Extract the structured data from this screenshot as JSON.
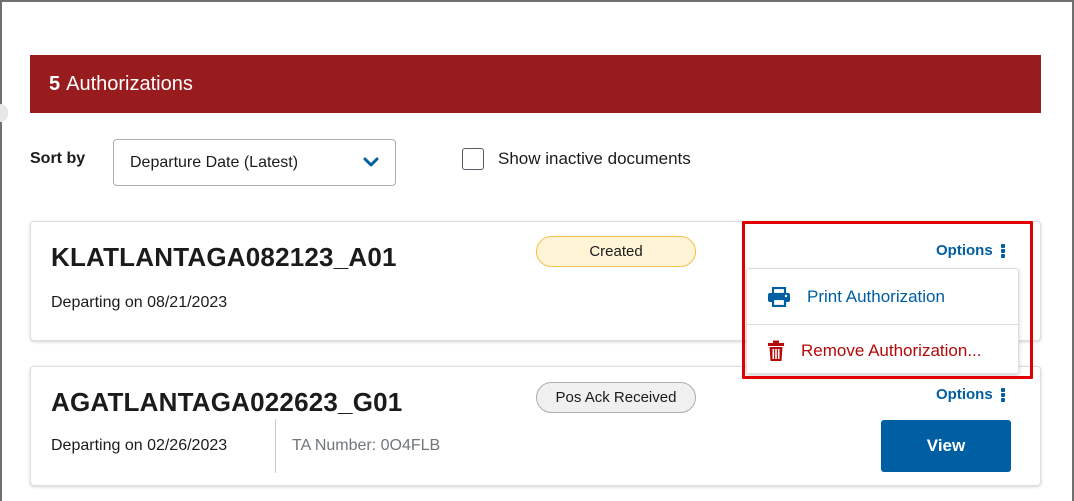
{
  "header": {
    "count": "5",
    "title": "Authorizations",
    "color": "#981b1e"
  },
  "controls": {
    "sort_label": "Sort by",
    "sort_value": "Departure Date (Latest)",
    "show_inactive_label": "Show inactive documents",
    "show_inactive_checked": false
  },
  "cards": [
    {
      "title": "KLATLANTAGA082123_A01",
      "departing": "Departing on 08/21/2023",
      "status": "Created",
      "options_label": "Options"
    },
    {
      "title": "AGATLANTAGA022623_G01",
      "departing": "Departing on 02/26/2023",
      "ta_number": "TA Number: 0O4FLB",
      "status": "Pos Ack Received",
      "options_label": "Options",
      "view_label": "View"
    }
  ],
  "options_menu": {
    "print_label": "Print Authorization",
    "print_icon": "printer-icon",
    "remove_label": "Remove Authorization...",
    "remove_icon": "trash-icon"
  },
  "colors": {
    "accent": "#005ea2",
    "danger": "#b50909",
    "highlight": "#e00000"
  }
}
